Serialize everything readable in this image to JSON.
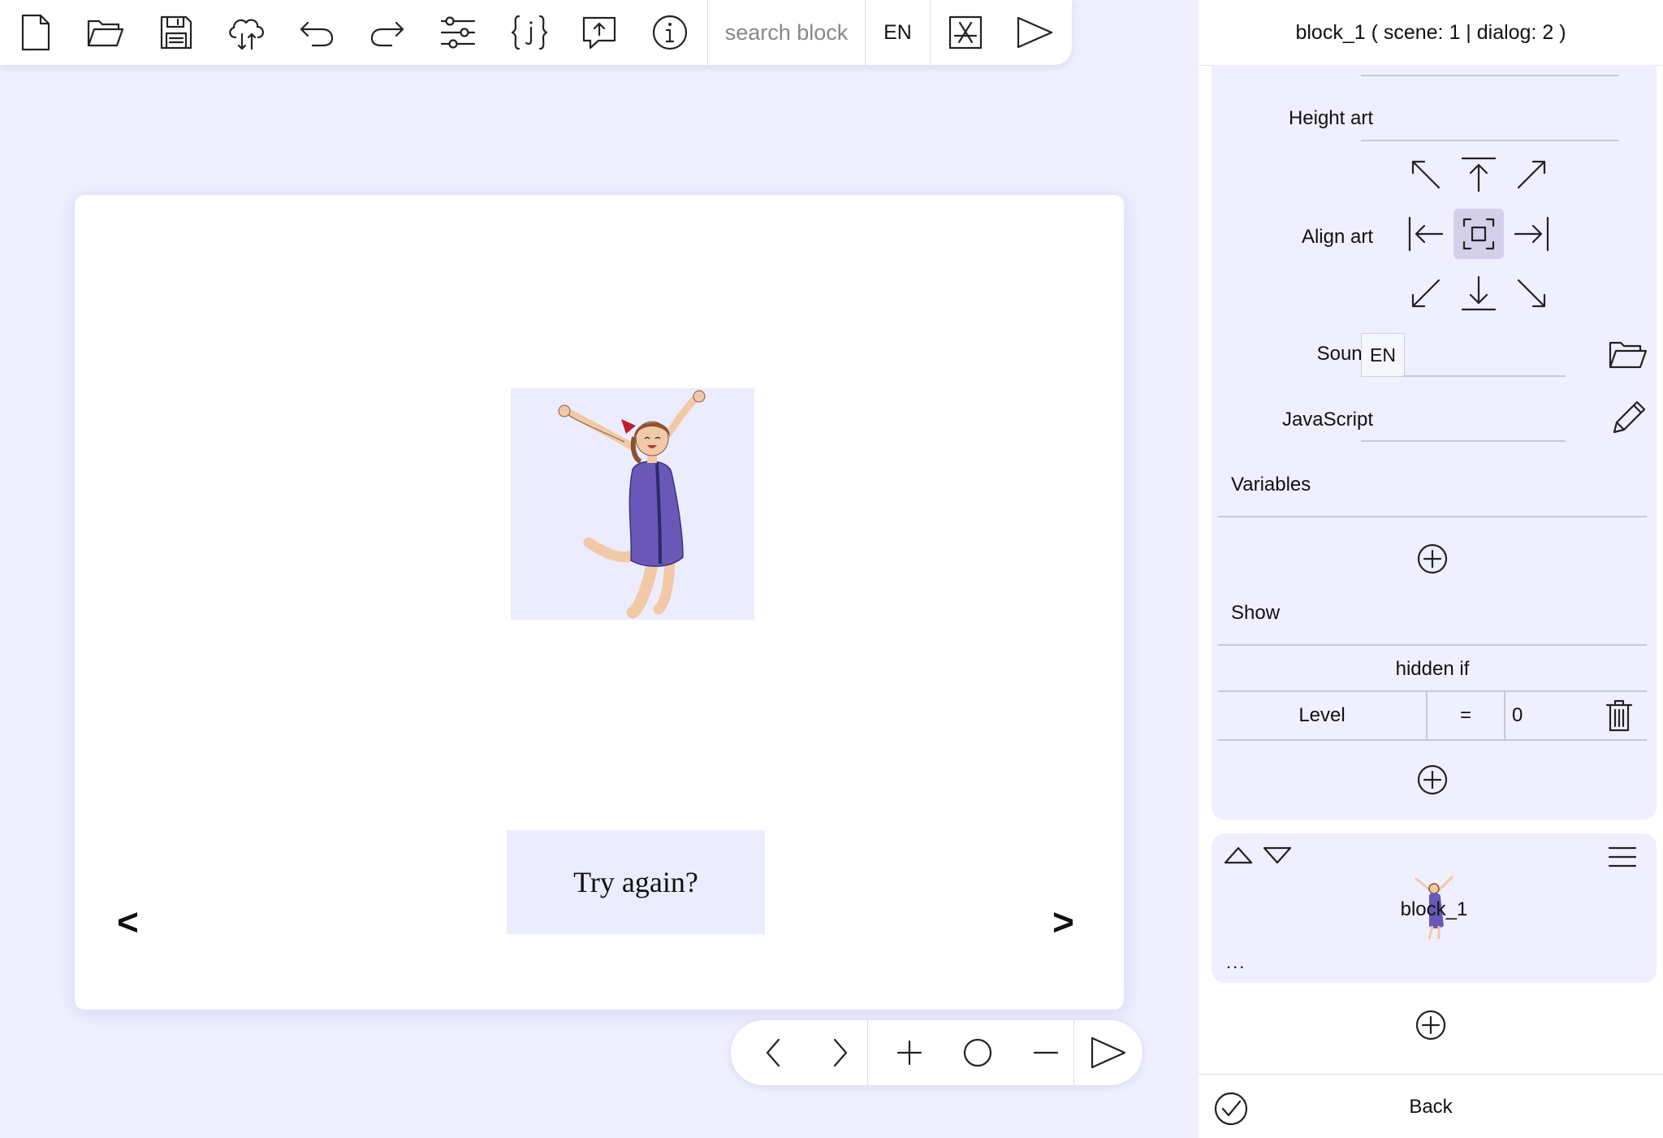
{
  "toolbar": {
    "search": {
      "placeholder": "search block",
      "value": ""
    },
    "language": "EN",
    "items": [
      {
        "icon": "new-file-icon"
      },
      {
        "icon": "open-folder-icon"
      },
      {
        "icon": "save-icon"
      },
      {
        "icon": "cloud-sync-icon"
      },
      {
        "icon": "undo-icon"
      },
      {
        "icon": "redo-icon"
      },
      {
        "icon": "settings-sliders-icon"
      },
      {
        "icon": "json-icon"
      },
      {
        "icon": "share-icon"
      },
      {
        "icon": "info-icon"
      },
      {
        "icon": "app-store-icon"
      },
      {
        "icon": "play-icon"
      }
    ]
  },
  "stage": {
    "button_label": "Try again?",
    "prev_label": "<",
    "next_label": ">"
  },
  "panel": {
    "header": "block_1 ( scene: 1 | dialog: 2 )",
    "height_art_label": "Height art",
    "align_art_label": "Align art",
    "align_selected": "center",
    "sound_label": "Sound",
    "sound_language": "EN",
    "javascript_label": "JavaScript",
    "variables_label": "Variables",
    "show_label": "Show",
    "hidden_if_label": "hidden if",
    "condition": {
      "variable": "Level",
      "operator": "=",
      "value": "0"
    },
    "list_item_name": "block_1",
    "list_item_more": "...",
    "back_label": "Back"
  },
  "colors": {
    "background": "#efefff",
    "panel_card": "#efefff",
    "align_active": "#d4d0ec"
  }
}
